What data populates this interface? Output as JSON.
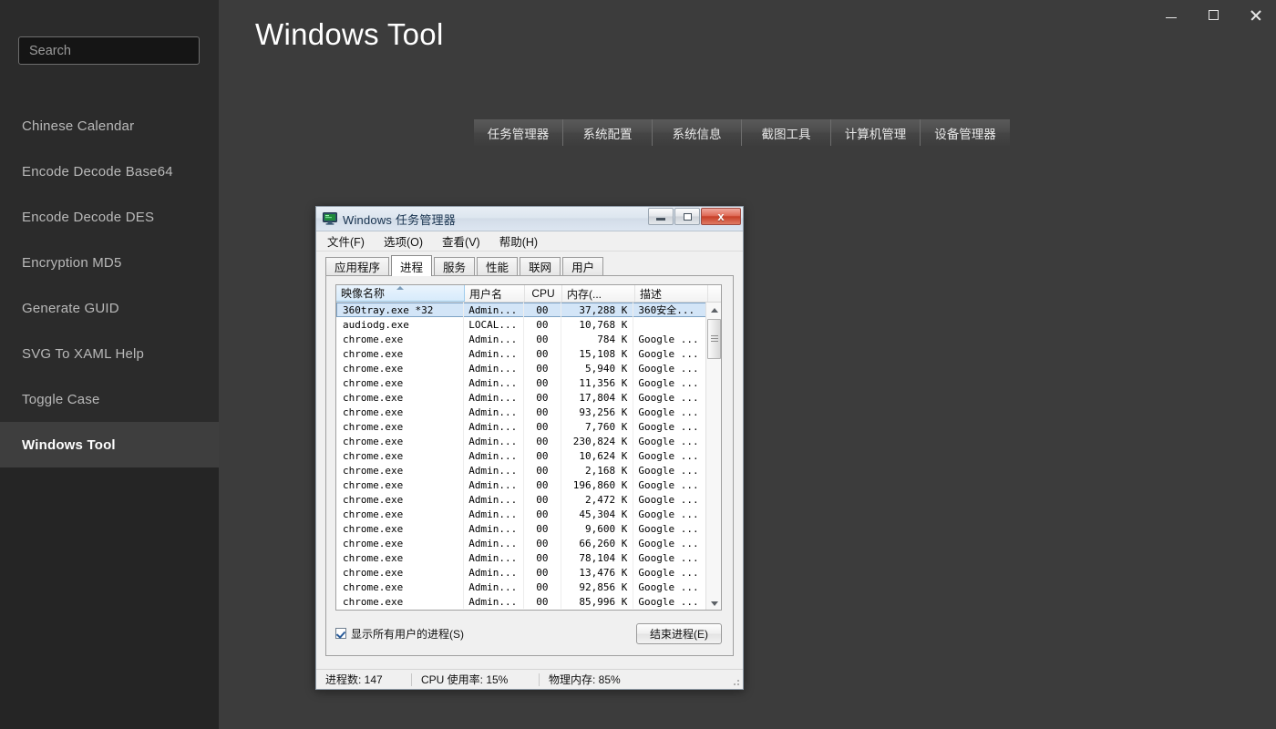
{
  "window": {
    "title": "Windows Tool",
    "controls": [
      {
        "name": "minimize",
        "label": "–"
      },
      {
        "name": "maximize",
        "label": "□"
      },
      {
        "name": "close",
        "label": "✕"
      }
    ]
  },
  "sidebar": {
    "search": {
      "value": "",
      "placeholder": "Search"
    },
    "items": [
      {
        "label": "Chinese Calendar",
        "selected": false
      },
      {
        "label": "Encode Decode Base64",
        "selected": false
      },
      {
        "label": "Encode Decode DES",
        "selected": false
      },
      {
        "label": "Encryption MD5",
        "selected": false
      },
      {
        "label": "Generate GUID",
        "selected": false
      },
      {
        "label": "SVG To XAML Help",
        "selected": false
      },
      {
        "label": "Toggle Case",
        "selected": false
      },
      {
        "label": "Windows Tool",
        "selected": true
      }
    ]
  },
  "toolbar": {
    "buttons": [
      {
        "label": "任务管理器"
      },
      {
        "label": "系统配置"
      },
      {
        "label": "系统信息"
      },
      {
        "label": "截图工具"
      },
      {
        "label": "计算机管理"
      },
      {
        "label": "设备管理器"
      }
    ]
  },
  "taskmgr": {
    "title": "Windows 任务管理器",
    "titlebar_buttons": {
      "minimize": "–",
      "maximize": "□",
      "close": "x"
    },
    "menu": [
      {
        "label": "文件(F)"
      },
      {
        "label": "选项(O)"
      },
      {
        "label": "查看(V)"
      },
      {
        "label": "帮助(H)"
      }
    ],
    "tabs": [
      {
        "label": "应用程序",
        "active": false
      },
      {
        "label": "进程",
        "active": true
      },
      {
        "label": "服务",
        "active": false
      },
      {
        "label": "性能",
        "active": false
      },
      {
        "label": "联网",
        "active": false
      },
      {
        "label": "用户",
        "active": false
      }
    ],
    "columns": [
      {
        "label": "映像名称",
        "sorted": true
      },
      {
        "label": "用户名",
        "sorted": false
      },
      {
        "label": "CPU",
        "sorted": false
      },
      {
        "label": "内存(...",
        "sorted": false
      },
      {
        "label": "描述",
        "sorted": false
      }
    ],
    "rows": [
      {
        "name": "360tray.exe *32",
        "user": "Admin...",
        "cpu": "00",
        "mem": "37,288 K",
        "desc": "360安全...",
        "selected": true
      },
      {
        "name": "audiodg.exe",
        "user": "LOCAL...",
        "cpu": "00",
        "mem": "10,768 K",
        "desc": "",
        "selected": false
      },
      {
        "name": "chrome.exe",
        "user": "Admin...",
        "cpu": "00",
        "mem": "784 K",
        "desc": "Google ...",
        "selected": false
      },
      {
        "name": "chrome.exe",
        "user": "Admin...",
        "cpu": "00",
        "mem": "15,108 K",
        "desc": "Google ...",
        "selected": false
      },
      {
        "name": "chrome.exe",
        "user": "Admin...",
        "cpu": "00",
        "mem": "5,940 K",
        "desc": "Google ...",
        "selected": false
      },
      {
        "name": "chrome.exe",
        "user": "Admin...",
        "cpu": "00",
        "mem": "11,356 K",
        "desc": "Google ...",
        "selected": false
      },
      {
        "name": "chrome.exe",
        "user": "Admin...",
        "cpu": "00",
        "mem": "17,804 K",
        "desc": "Google ...",
        "selected": false
      },
      {
        "name": "chrome.exe",
        "user": "Admin...",
        "cpu": "00",
        "mem": "93,256 K",
        "desc": "Google ...",
        "selected": false
      },
      {
        "name": "chrome.exe",
        "user": "Admin...",
        "cpu": "00",
        "mem": "7,760 K",
        "desc": "Google ...",
        "selected": false
      },
      {
        "name": "chrome.exe",
        "user": "Admin...",
        "cpu": "00",
        "mem": "230,824 K",
        "desc": "Google ...",
        "selected": false
      },
      {
        "name": "chrome.exe",
        "user": "Admin...",
        "cpu": "00",
        "mem": "10,624 K",
        "desc": "Google ...",
        "selected": false
      },
      {
        "name": "chrome.exe",
        "user": "Admin...",
        "cpu": "00",
        "mem": "2,168 K",
        "desc": "Google ...",
        "selected": false
      },
      {
        "name": "chrome.exe",
        "user": "Admin...",
        "cpu": "00",
        "mem": "196,860 K",
        "desc": "Google ...",
        "selected": false
      },
      {
        "name": "chrome.exe",
        "user": "Admin...",
        "cpu": "00",
        "mem": "2,472 K",
        "desc": "Google ...",
        "selected": false
      },
      {
        "name": "chrome.exe",
        "user": "Admin...",
        "cpu": "00",
        "mem": "45,304 K",
        "desc": "Google ...",
        "selected": false
      },
      {
        "name": "chrome.exe",
        "user": "Admin...",
        "cpu": "00",
        "mem": "9,600 K",
        "desc": "Google ...",
        "selected": false
      },
      {
        "name": "chrome.exe",
        "user": "Admin...",
        "cpu": "00",
        "mem": "66,260 K",
        "desc": "Google ...",
        "selected": false
      },
      {
        "name": "chrome.exe",
        "user": "Admin...",
        "cpu": "00",
        "mem": "78,104 K",
        "desc": "Google ...",
        "selected": false
      },
      {
        "name": "chrome.exe",
        "user": "Admin...",
        "cpu": "00",
        "mem": "13,476 K",
        "desc": "Google ...",
        "selected": false
      },
      {
        "name": "chrome.exe",
        "user": "Admin...",
        "cpu": "00",
        "mem": "92,856 K",
        "desc": "Google ...",
        "selected": false
      },
      {
        "name": "chrome.exe",
        "user": "Admin...",
        "cpu": "00",
        "mem": "85,996 K",
        "desc": "Google ...",
        "selected": false
      }
    ],
    "show_all_users_label": "显示所有用户的进程(S)",
    "show_all_users_checked": true,
    "end_process_label": "结束进程(E)",
    "status": {
      "processes": "进程数: 147",
      "cpu": "CPU 使用率: 15%",
      "memory": "物理内存: 85%"
    }
  },
  "colors": {
    "app_bg": "#3c3c3c",
    "sidebar_bg": "#2b2b2b",
    "sidebar_bg_lower": "#252525",
    "sidebar_selected": "#3e3e3e",
    "accent_selection": "#d3e5f7"
  }
}
